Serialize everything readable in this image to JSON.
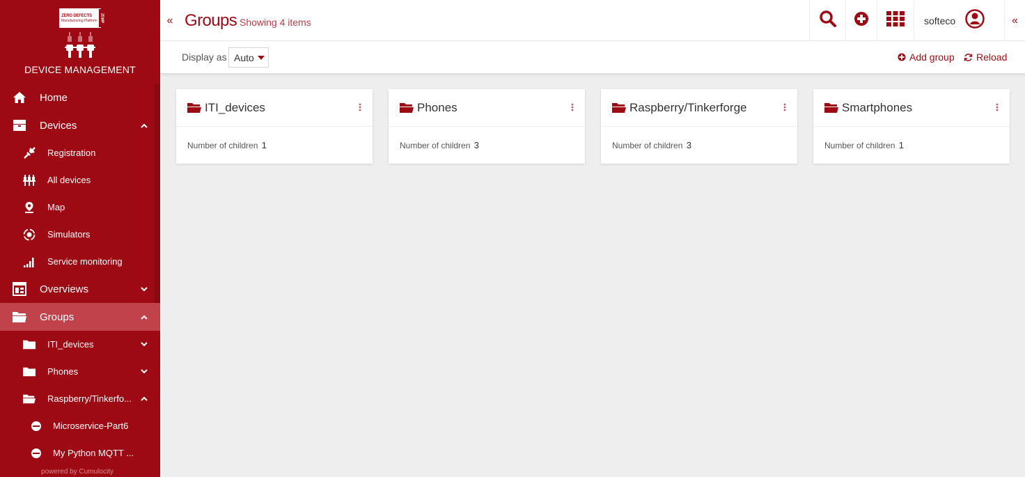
{
  "brand": {
    "logo_line1": "ZERO DEFECTS",
    "logo_line2": "Manufacturing Platform",
    "logo_side": "ZDMP",
    "app_title": "DEVICE MANAGEMENT",
    "powered_by": "powered by Cumulocity"
  },
  "sidebar": {
    "items": [
      {
        "label": "Home",
        "icon": "home-icon"
      },
      {
        "label": "Devices",
        "icon": "devices-icon",
        "expanded": true
      },
      {
        "label": "Registration",
        "icon": "registration-icon"
      },
      {
        "label": "All devices",
        "icon": "all-devices-icon"
      },
      {
        "label": "Map",
        "icon": "map-pin-icon"
      },
      {
        "label": "Simulators",
        "icon": "simulator-icon"
      },
      {
        "label": "Service monitoring",
        "icon": "signal-bars-icon"
      },
      {
        "label": "Overviews",
        "icon": "overview-icon",
        "expanded": false
      },
      {
        "label": "Groups",
        "icon": "folder-open-icon",
        "expanded": true,
        "active": true
      },
      {
        "label": "ITI_devices",
        "icon": "folder-icon",
        "expanded": false
      },
      {
        "label": "Phones",
        "icon": "folder-icon",
        "expanded": false
      },
      {
        "label": "Raspberry/Tinkerfo...",
        "icon": "folder-open-icon",
        "expanded": true
      },
      {
        "label": "Microservice-Part6",
        "icon": "device-icon"
      },
      {
        "label": "My Python MQTT ...",
        "icon": "device-icon"
      }
    ]
  },
  "header": {
    "title": "Groups",
    "subtitle": "Showing 4 items",
    "username": "softeco",
    "collapse_left": "«",
    "collapse_right": "«"
  },
  "actionbar": {
    "display_label": "Display as",
    "display_value": "Auto",
    "add_group": "Add group",
    "reload": "Reload"
  },
  "groups": [
    {
      "name": "ITI_devices",
      "children_label": "Number of children",
      "children_count": "1"
    },
    {
      "name": "Phones",
      "children_label": "Number of children",
      "children_count": "3"
    },
    {
      "name": "Raspberry/Tinkerforge",
      "children_label": "Number of children",
      "children_count": "3"
    },
    {
      "name": "Smartphones",
      "children_label": "Number of children",
      "children_count": "1"
    }
  ],
  "colors": {
    "brand": "#9e0a13",
    "sidebar_active": "#c2424c",
    "background": "#eeeeee"
  }
}
